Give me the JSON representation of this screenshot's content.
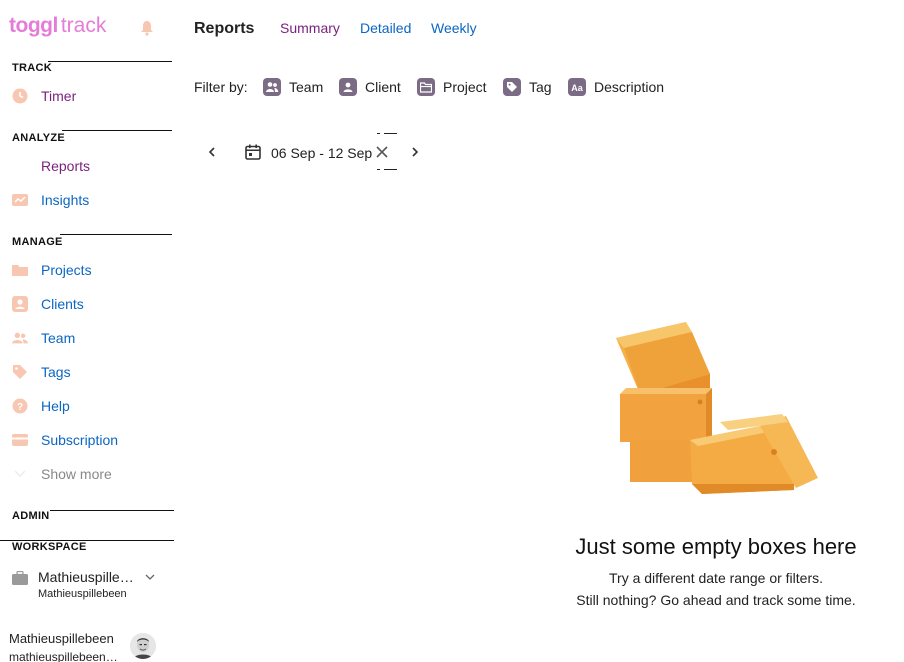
{
  "brand": {
    "logo_main": "toggl",
    "logo_sub": "track"
  },
  "sidebar": {
    "sections": {
      "track": "TRACK",
      "analyze": "ANALYZE",
      "manage": "MANAGE",
      "admin": "ADMIN",
      "workspace": "WORKSPACE"
    },
    "items": {
      "timer": "Timer",
      "reports": "Reports",
      "insights": "Insights",
      "projects": "Projects",
      "clients": "Clients",
      "team": "Team",
      "tags": "Tags",
      "help": "Help",
      "subscription": "Subscription",
      "show_more": "Show more"
    },
    "workspace": {
      "name": "Mathieuspillebeen's workspace",
      "sub": "Mathieuspillebeen"
    },
    "user": {
      "name": "Mathieuspillebeen",
      "email": "mathieuspillebeen@..."
    }
  },
  "main": {
    "title": "Reports",
    "tabs": {
      "summary": "Summary",
      "detailed": "Detailed",
      "weekly": "Weekly"
    },
    "filters": {
      "label": "Filter by:",
      "team": "Team",
      "client": "Client",
      "project": "Project",
      "tag": "Tag",
      "description": "Description"
    },
    "date_range": "06 Sep - 12 Sep",
    "empty": {
      "title": "Just some empty boxes here",
      "line1": "Try a different date range or filters.",
      "line2": "Still nothing? Go ahead and track some time."
    }
  },
  "colors": {
    "brand_pink": "#e57cd8",
    "link_blue": "#0b66c2",
    "active_purple": "#7a1f7e",
    "icon_peach": "#f7c7b2",
    "filter_icon_bg": "#7b6b85",
    "box_orange": "#f2a340"
  },
  "icons": [
    "bell-icon",
    "clock-icon",
    "insights-icon",
    "folder-icon",
    "client-icon",
    "team-icon",
    "tag-icon",
    "help-icon",
    "subscription-icon",
    "chevron-down-icon",
    "briefcase-icon",
    "calendar-icon",
    "close-icon",
    "chevron-left-icon",
    "chevron-right-icon"
  ]
}
